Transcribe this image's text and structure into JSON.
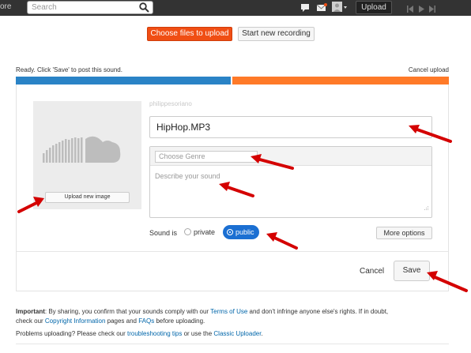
{
  "topbar": {
    "more_label": "ore",
    "search_placeholder": "Search",
    "upload_label": "Upload"
  },
  "actions": {
    "choose_files_label": "Choose files to upload",
    "start_recording_label": "Start new recording"
  },
  "upload": {
    "status_text": "Ready. Click 'Save' to post this sound.",
    "cancel_upload_label": "Cancel upload",
    "progress": 0.5
  },
  "form": {
    "upload_image_label": "Upload new image",
    "username": "philippesoriano",
    "title_value": "HipHop.MP3",
    "genre_placeholder": "Choose Genre",
    "description_placeholder": "Describe your sound",
    "sound_is_label": "Sound is",
    "private_label": "private",
    "public_label": "public",
    "more_options_label": "More options",
    "cancel_label": "Cancel",
    "save_label": "Save"
  },
  "footer": {
    "important_label": "Important",
    "line1_a": ": By sharing, you confirm that your sounds comply with our ",
    "terms_link": "Terms of Use",
    "line1_b": " and don't infringe anyone else's rights. If in doubt,",
    "line2_a": "check our ",
    "copyright_link": "Copyright Information",
    "line2_b": " pages and ",
    "faqs_link": "FAQs",
    "line2_c": " before uploading.",
    "problems_a": "Problems uploading? Please check our ",
    "troubleshooting_link": "troubleshooting tips",
    "problems_b": " or use the ",
    "classic_link": "Classic Uploader",
    "problems_c": "."
  },
  "colors": {
    "topbar_bg": "#333333",
    "accent_orange": "#f04e14",
    "progress_blue": "#2a83c6",
    "progress_orange": "#ff7a28",
    "public_blue": "#1b6fd2",
    "arrow_red": "#d40000"
  },
  "icons": [
    "search-icon",
    "chat-icon",
    "mail-icon",
    "user-avatar-icon",
    "prev-icon",
    "play-icon",
    "next-icon",
    "soundcloud-cloud-icon",
    "resize-grip-icon",
    "annotation-arrow"
  ]
}
